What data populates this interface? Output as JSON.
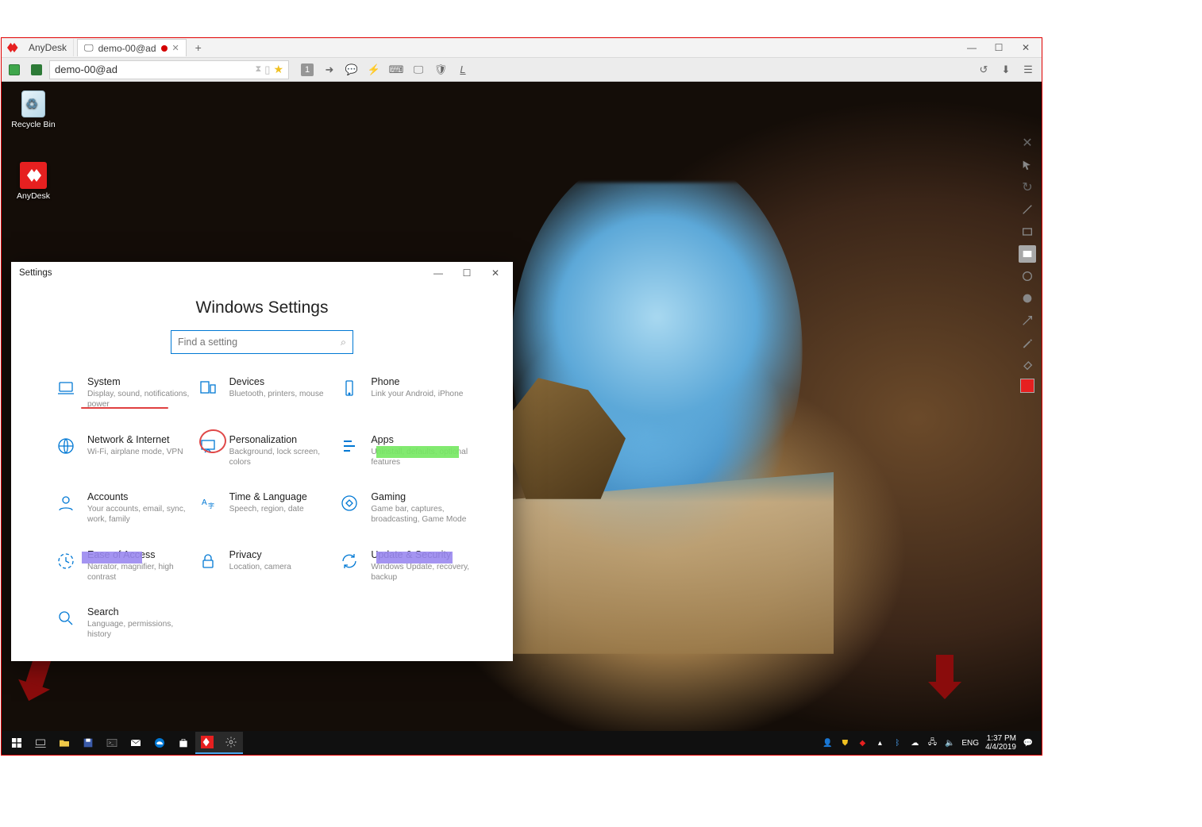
{
  "anydesk": {
    "app_name": "AnyDesk",
    "tabs": [
      {
        "label": "demo-00@ad"
      }
    ],
    "new_tab": "+",
    "address": "demo-00@ad",
    "toolbar_num": "1",
    "window": {
      "min": "—",
      "max": "☐",
      "close": "✕"
    }
  },
  "desktop": {
    "icons": [
      {
        "name": "recycle-bin",
        "label": "Recycle Bin"
      },
      {
        "name": "anydesk-app",
        "label": "AnyDesk"
      }
    ]
  },
  "whiteboard_tools": [
    "close",
    "cursor",
    "redo",
    "line",
    "rect",
    "rect-fill",
    "circle",
    "circle-fill",
    "arrow",
    "pen",
    "eraser"
  ],
  "settings": {
    "title": "Settings",
    "heading": "Windows Settings",
    "search_placeholder": "Find a setting",
    "window": {
      "min": "—",
      "max": "☐",
      "close": "✕"
    },
    "categories": [
      {
        "key": "system",
        "title": "System",
        "desc": "Display, sound, notifications, power"
      },
      {
        "key": "devices",
        "title": "Devices",
        "desc": "Bluetooth, printers, mouse"
      },
      {
        "key": "phone",
        "title": "Phone",
        "desc": "Link your Android, iPhone"
      },
      {
        "key": "network",
        "title": "Network & Internet",
        "desc": "Wi-Fi, airplane mode, VPN"
      },
      {
        "key": "personalization",
        "title": "Personalization",
        "desc": "Background, lock screen, colors"
      },
      {
        "key": "apps",
        "title": "Apps",
        "desc": "Uninstall, defaults, optional features"
      },
      {
        "key": "accounts",
        "title": "Accounts",
        "desc": "Your accounts, email, sync, work, family"
      },
      {
        "key": "time",
        "title": "Time & Language",
        "desc": "Speech, region, date"
      },
      {
        "key": "gaming",
        "title": "Gaming",
        "desc": "Game bar, captures, broadcasting, Game Mode"
      },
      {
        "key": "ease",
        "title": "Ease of Access",
        "desc": "Narrator, magnifier, high contrast"
      },
      {
        "key": "privacy",
        "title": "Privacy",
        "desc": "Location, camera"
      },
      {
        "key": "update",
        "title": "Update & Security",
        "desc": "Windows Update, recovery, backup"
      },
      {
        "key": "search",
        "title": "Search",
        "desc": "Language, permissions, history"
      }
    ]
  },
  "taskbar": {
    "apps": [
      "start",
      "taskview",
      "explorer",
      "save",
      "terminal",
      "mail",
      "edge",
      "store",
      "anydesk",
      "settings"
    ],
    "lang": "ENG",
    "time": "1:37 PM",
    "date": "4/4/2019"
  },
  "annotations": {
    "arrows": [
      "pointer-to-system",
      "pointer-to-start",
      "pointer-to-tray"
    ],
    "highlights": [
      "apps-green",
      "ease-purple",
      "update-purple"
    ],
    "underline": "system-underline",
    "circle": "personalization-circle"
  }
}
